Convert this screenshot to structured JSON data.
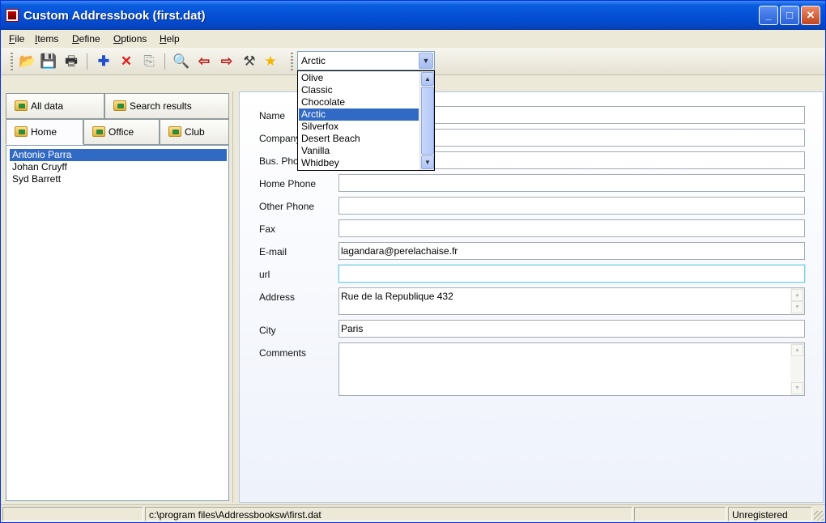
{
  "window": {
    "title": "Custom Addressbook (first.dat)"
  },
  "title_buttons": {
    "minimize": "_",
    "maximize": "□",
    "close": "✕"
  },
  "menu": [
    {
      "label": "File",
      "key": "F",
      "rest": "ile"
    },
    {
      "label": "Items",
      "key": "I",
      "rest": "tems"
    },
    {
      "label": "Define",
      "key": "D",
      "rest": "efine"
    },
    {
      "label": "Options",
      "key": "O",
      "rest": "ptions"
    },
    {
      "label": "Help",
      "key": "H",
      "rest": "elp"
    }
  ],
  "toolbar": {
    "icons": [
      "open-folder-icon",
      "save-icon",
      "print-icon",
      "add-icon",
      "delete-icon",
      "copy-icon",
      "search-icon",
      "import-icon",
      "export-icon",
      "tools-icon",
      "favorite-icon"
    ],
    "glyphs": {
      "open": "📂",
      "save": "💾",
      "print": "🖶",
      "add": "✚",
      "delete": "✕",
      "copy": "⎘",
      "search": "🔍",
      "import": "⇦",
      "export": "⇨",
      "tools": "⚒",
      "favorite": "★"
    }
  },
  "theme_combo": {
    "selected": "Arctic",
    "options": [
      "Olive",
      "Classic",
      "Chocolate",
      "Arctic",
      "Silverfox",
      "Desert Beach",
      "Vanilla",
      "Whidbey"
    ],
    "selected_index": 3
  },
  "tabs": {
    "top": [
      "All data",
      "Search results"
    ],
    "bottom": [
      "Home",
      "Office",
      "Club"
    ],
    "active": "Home"
  },
  "contacts": [
    "Antonio Parra",
    "Johan Cruyff",
    "Syd Barrett"
  ],
  "selected_contact": "Antonio Parra",
  "form": {
    "labels": {
      "name": "Name",
      "company": "Company",
      "bus_phone": "Bus. Phone",
      "home_phone": "Home Phone",
      "other_phone": "Other Phone",
      "fax": "Fax",
      "email": "E-mail",
      "url": "url",
      "address": "Address",
      "city": "City",
      "comments": "Comments"
    },
    "values": {
      "name": "",
      "company": "",
      "bus_phone": "",
      "home_phone": "",
      "other_phone": "",
      "fax": "",
      "email": "lagandara@perelachaise.fr",
      "url": "",
      "address": "Rue de la Republique 432",
      "city": "Paris",
      "comments": ""
    }
  },
  "status": {
    "path": "c:\\program files\\Addressbooksw\\first.dat",
    "registration": "Unregistered"
  }
}
